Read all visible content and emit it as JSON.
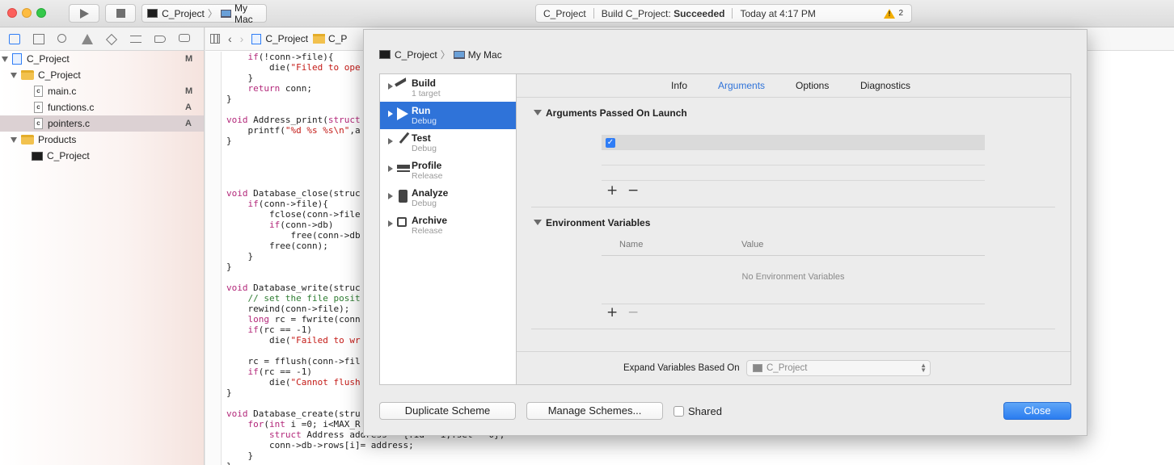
{
  "toolbar": {
    "scheme": "C_Project",
    "destination": "My Mac",
    "activity": {
      "project": "C_Project",
      "build_prefix": "Build C_Project:",
      "build_status": "Succeeded",
      "time": "Today at 4:17 PM",
      "warning_count": "2",
      "warning_icon": "warning-triangle-icon"
    }
  },
  "navigator": {
    "items": [
      {
        "label": "C_Project",
        "status": "M",
        "icon": "project-icon"
      },
      {
        "label": "C_Project",
        "status": "",
        "icon": "folder-icon"
      },
      {
        "label": "main.c",
        "status": "M",
        "icon": "c-file-icon"
      },
      {
        "label": "functions.c",
        "status": "A",
        "icon": "c-file-icon"
      },
      {
        "label": "pointers.c",
        "status": "A",
        "icon": "c-file-icon"
      },
      {
        "label": "Products",
        "status": "",
        "icon": "folder-icon"
      },
      {
        "label": "C_Project",
        "status": "",
        "icon": "executable-icon"
      }
    ]
  },
  "jump_bar": {
    "project": "C_Project",
    "folder": "C_P"
  },
  "code_lines": [
    "    if(!conn->file){",
    "        die(\"Filed to ope",
    "    }",
    "    return conn;",
    "}",
    "",
    "void Address_print(struct",
    "    printf(\"%d %s %s\\n\",a",
    "}",
    "",
    "",
    "",
    "",
    "void Database_close(struc",
    "    if(conn->file){",
    "        fclose(conn->file",
    "        if(conn->db)",
    "            free(conn->db",
    "        free(conn);",
    "    }",
    "}",
    "",
    "void Database_write(struc",
    "    // set the file posit",
    "    rewind(conn->file);",
    "    long rc = fwrite(conn",
    "    if(rc == -1)",
    "        die(\"Failed to wr",
    "",
    "    rc = fflush(conn->fil",
    "    if(rc == -1)",
    "        die(\"Cannot flush",
    "}",
    "",
    "void Database_create(stru",
    "    for(int i =0; i<MAX_R",
    "        struct Address address = {.id = i,.set = 0};",
    "        conn->db->rows[i]= address;",
    "    }",
    "}"
  ],
  "sheet": {
    "crumb_scheme": "C_Project",
    "crumb_destination": "My Mac",
    "actions": [
      {
        "name": "Build",
        "sub": "1 target",
        "icon": "hammer-icon"
      },
      {
        "name": "Run",
        "sub": "Debug",
        "icon": "play-icon"
      },
      {
        "name": "Test",
        "sub": "Debug",
        "icon": "wrench-icon"
      },
      {
        "name": "Profile",
        "sub": "Release",
        "icon": "instruments-icon"
      },
      {
        "name": "Analyze",
        "sub": "Debug",
        "icon": "analyze-icon"
      },
      {
        "name": "Archive",
        "sub": "Release",
        "icon": "archive-icon"
      }
    ],
    "tabs": [
      "Info",
      "Arguments",
      "Options",
      "Diagnostics"
    ],
    "active_tab": "Arguments",
    "arguments_title": "Arguments Passed On Launch",
    "env_title": "Environment Variables",
    "env_col_name": "Name",
    "env_col_value": "Value",
    "env_empty": "No Environment Variables",
    "add_symbol": "+",
    "remove_symbol": "−",
    "expand_label": "Expand Variables Based On",
    "expand_value": "C_Project",
    "duplicate_label": "Duplicate Scheme",
    "manage_label": "Manage Schemes...",
    "shared_label": "Shared",
    "close_label": "Close"
  },
  "colors": {
    "accent": "#2f73d9",
    "warning": "#f5b000"
  }
}
